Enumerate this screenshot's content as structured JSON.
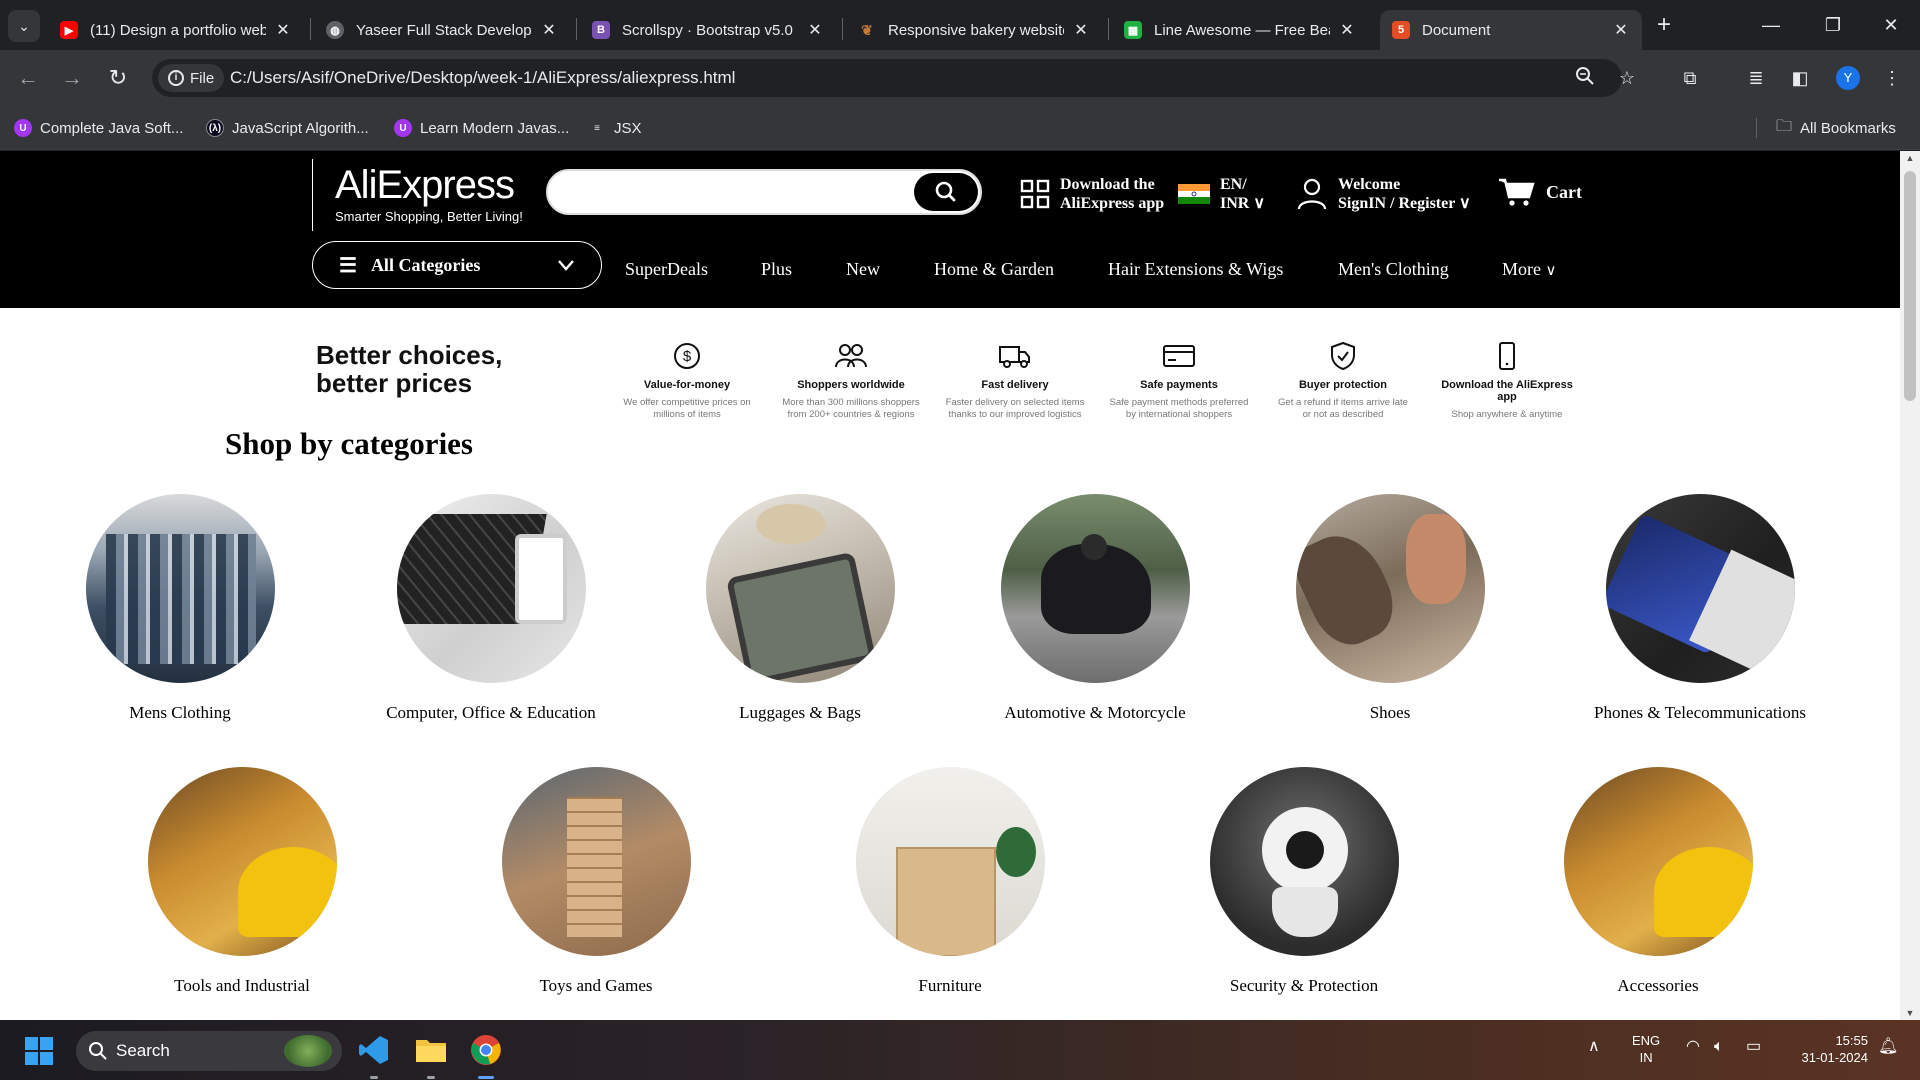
{
  "browser": {
    "tabs": [
      {
        "title": "(11) Design a portfolio web",
        "favicon": "youtube-icon",
        "color": "#ff0000"
      },
      {
        "title": "Yaseer Full Stack Developer",
        "favicon": "globe-icon",
        "color": "#9aa0a6"
      },
      {
        "title": "Scrollspy · Bootstrap v5.0",
        "favicon": "bootstrap-icon",
        "color": "#7952b3"
      },
      {
        "title": "Responsive bakery website",
        "favicon": "bakery-icon",
        "color": "#c47a3a"
      },
      {
        "title": "Line Awesome — Free Beau",
        "favicon": "line-awesome-icon",
        "color": "#1fb141"
      },
      {
        "title": "Document",
        "favicon": "html5-icon",
        "color": "#e44d26"
      }
    ],
    "active_tab_index": 5,
    "new_tab_label": "+",
    "omnibox": {
      "chip_label": "File",
      "url": "C:/Users/Asif/OneDrive/Desktop/week-1/AliExpress/aliexpress.html"
    },
    "avatar_letter": "Y",
    "bookmarks": [
      {
        "label": "Complete Java Soft...",
        "icon": "udemy-icon",
        "color": "#a435f0"
      },
      {
        "label": "JavaScript Algorith...",
        "icon": "freecodecamp-icon",
        "color": "#0a0a23"
      },
      {
        "label": "Learn Modern Javas...",
        "icon": "udemy-icon",
        "color": "#a435f0"
      },
      {
        "label": "JSX",
        "icon": "jsx-icon",
        "color": "#e8eaed"
      }
    ],
    "all_bookmarks_label": "All Bookmarks"
  },
  "header": {
    "logo": "AliExpress",
    "tagline": "Smarter Shopping, Better Living!",
    "search_placeholder": "",
    "download_line1": "Download the",
    "download_line2": "AliExpress app",
    "lang_line1": "EN/",
    "lang_line2": "INR",
    "welcome_line1": "Welcome",
    "welcome_line2": "SignIN / Register",
    "cart_label": "Cart",
    "all_categories": "All Categories",
    "nav_links": [
      "SuperDeals",
      "Plus",
      "New",
      "Home & Garden",
      "Hair Extensions & Wigs",
      "Men's Clothing",
      "More"
    ]
  },
  "value_props": {
    "heading_line1": "Better choices,",
    "heading_line2": "better prices",
    "items": [
      {
        "icon": "dollar-circle-icon",
        "title": "Value-for-money",
        "desc1": "We offer competitive prices on",
        "desc2": "millions of items"
      },
      {
        "icon": "users-icon",
        "title": "Shoppers worldwide",
        "desc1": "More than 300 millions shoppers",
        "desc2": "from 200+ countries & regions"
      },
      {
        "icon": "truck-icon",
        "title": "Fast delivery",
        "desc1": "Faster delivery on selected items",
        "desc2": "thanks to our improved logistics"
      },
      {
        "icon": "credit-card-icon",
        "title": "Safe payments",
        "desc1": "Safe payment methods preferred",
        "desc2": "by international shoppers"
      },
      {
        "icon": "shield-check-icon",
        "title": "Buyer protection",
        "desc1": "Get a refund if items arrive late",
        "desc2": "or not as described"
      },
      {
        "icon": "smartphone-icon",
        "title": "Download the AliExpress app",
        "desc1": "Shop anywhere & anytime",
        "desc2": ""
      }
    ]
  },
  "categories": {
    "title": "Shop by categories",
    "row1": [
      "Mens Clothing",
      "Computer, Office & Education",
      "Luggages & Bags",
      "Automotive & Motorcycle",
      "Shoes",
      "Phones & Telecommunications"
    ],
    "row2": [
      "Tools and Industrial",
      "Toys and Games",
      "Furniture",
      "Security & Protection",
      "Accessories"
    ]
  },
  "taskbar": {
    "search_label": "Search",
    "lang_line1": "ENG",
    "lang_line2": "IN",
    "time": "15:55",
    "date": "31-01-2024"
  }
}
